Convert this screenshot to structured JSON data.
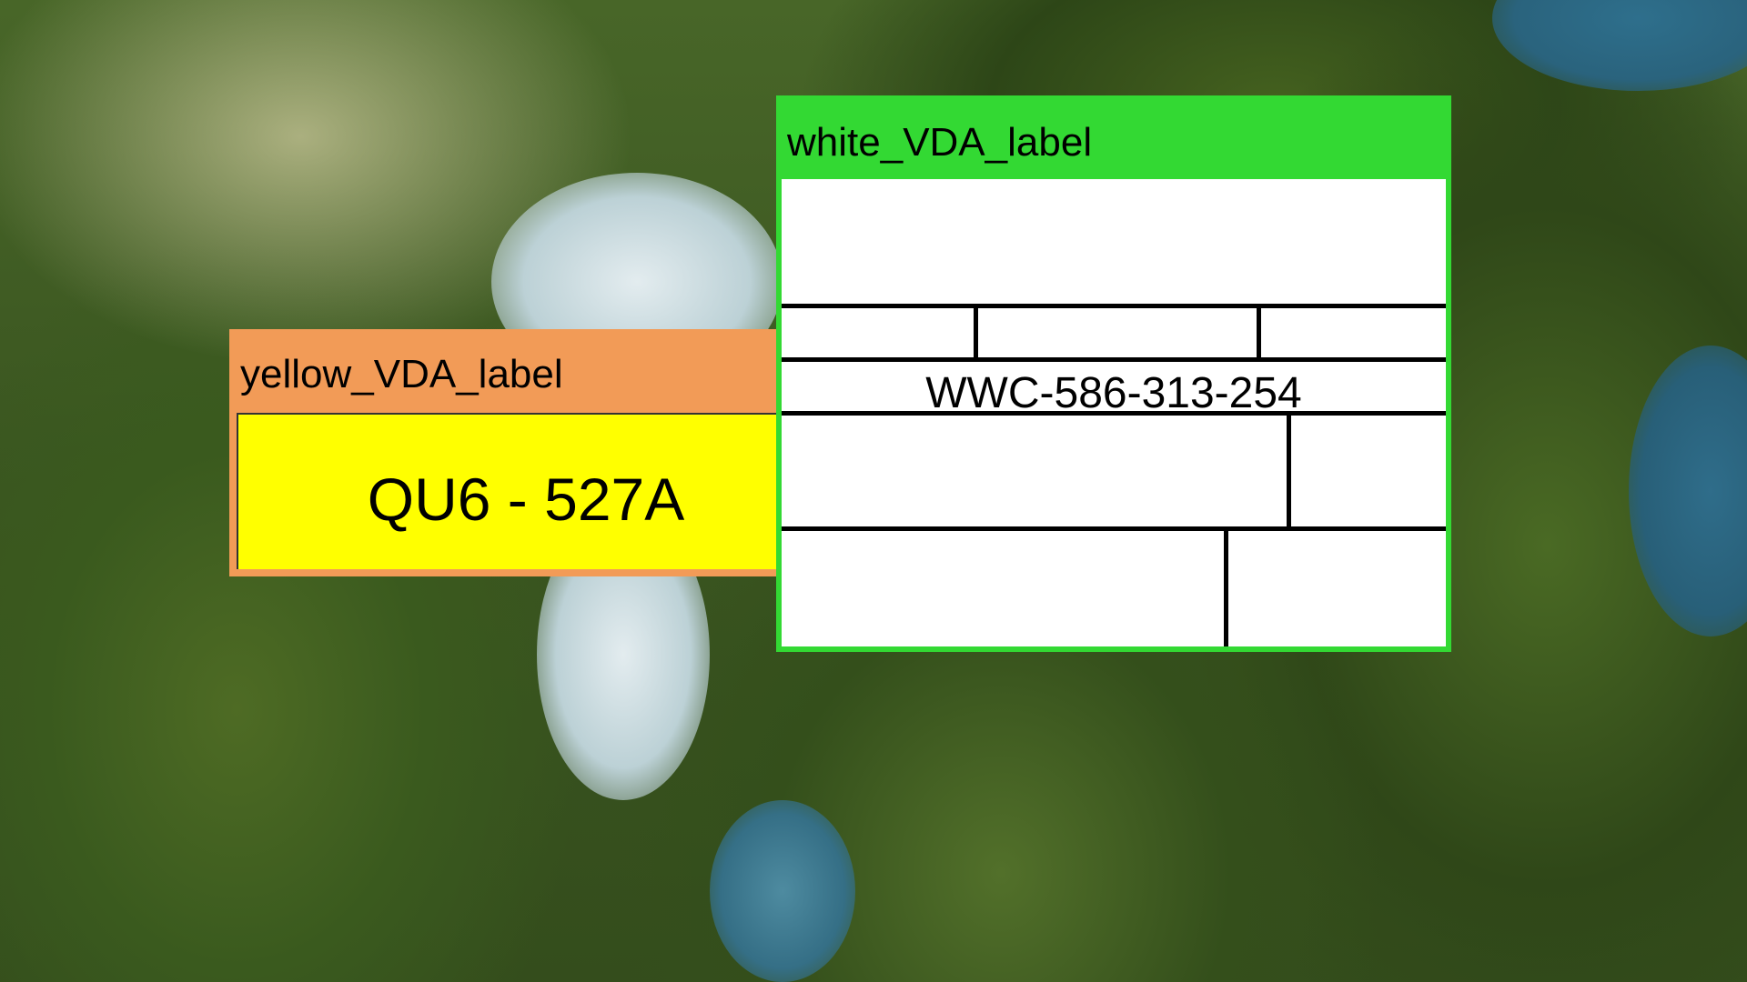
{
  "labels": {
    "yellow": {
      "title": "yellow_VDA_label",
      "plate_text": "QU6 - 527A",
      "header_color": "#f29b57",
      "body_color": "#ffff00"
    },
    "white": {
      "title": "white_VDA_label",
      "code_text": "WWC-586-313-254",
      "header_color": "#33d933",
      "body_color": "#ffffff"
    }
  }
}
